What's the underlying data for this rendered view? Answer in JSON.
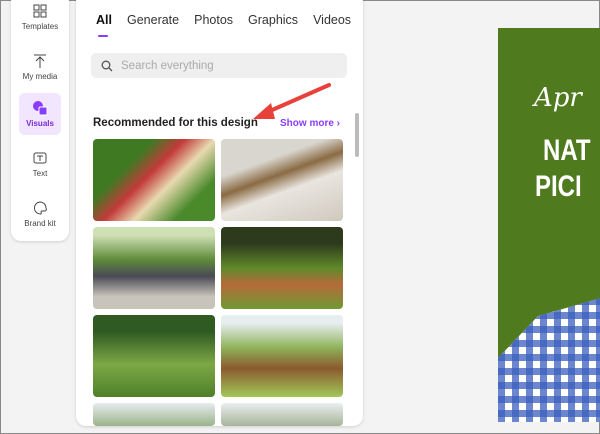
{
  "sidebar": {
    "items": [
      {
        "label": "Templates"
      },
      {
        "label": "My media"
      },
      {
        "label": "Visuals"
      },
      {
        "label": "Text"
      },
      {
        "label": "Brand kit"
      }
    ]
  },
  "tabs": [
    {
      "label": "All"
    },
    {
      "label": "Generate"
    },
    {
      "label": "Photos"
    },
    {
      "label": "Graphics"
    },
    {
      "label": "Videos"
    }
  ],
  "search": {
    "placeholder": "Search everything"
  },
  "section": {
    "title": "Recommended for this design",
    "show_more": "Show more ›"
  },
  "canvas": {
    "script_text": "Apr",
    "title_line1": "NAT",
    "title_line2": "PICI"
  },
  "colors": {
    "accent": "#8b3dff",
    "annotation": "#e8413c"
  }
}
